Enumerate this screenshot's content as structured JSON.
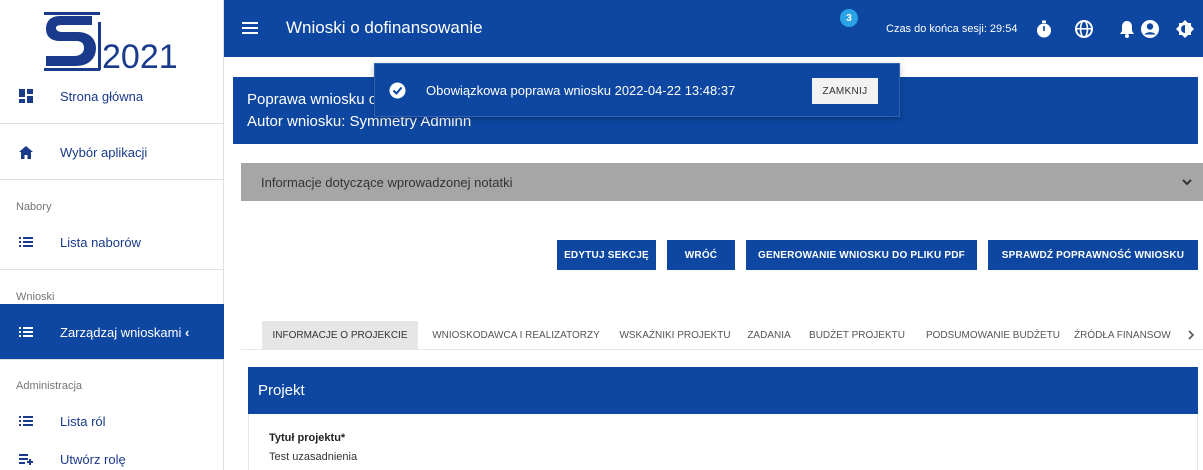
{
  "logo": {
    "text": "2021"
  },
  "sidebar": {
    "items": [
      {
        "label": "Strona główna",
        "icon": "dashboard-icon"
      },
      {
        "label": "Wybór aplikacji",
        "icon": "home-icon"
      },
      {
        "label": "Lista naborów",
        "icon": "list-icon"
      },
      {
        "label": "Zarządzaj wnioskami",
        "icon": "list-icon",
        "suffix": "‹"
      },
      {
        "label": "Lista ról",
        "icon": "list-icon"
      },
      {
        "label": "Utwórz rolę",
        "icon": "playlist-add-icon"
      }
    ],
    "sections": [
      "Nabory",
      "Wnioski",
      "Administracja"
    ]
  },
  "topbar": {
    "title": "Wnioski o dofinansowanie",
    "session": "Czas do końca sesji: 29:54",
    "notifications_count": "3"
  },
  "header": {
    "line1": "Poprawa wniosku o dofinansowanie - Test uzasadnienia",
    "line2": "Autor wniosku: Symmetry Adminn"
  },
  "toast": {
    "message": "Obowiązkowa poprawa wniosku 2022-04-22 13:48:37",
    "close_label": "ZAMKNIJ"
  },
  "accordion": {
    "label": "Informacje dotyczące wprowadzonej notatki"
  },
  "actions": {
    "edit": "EDYTUJ SEKCJĘ",
    "back": "WRÓĆ",
    "pdf": "GENEROWANIE WNIOSKU DO PLIKU PDF",
    "validate": "SPRAWDŹ POPRAWNOŚĆ WNIOSKU"
  },
  "tabs": [
    "INFORMACJE O PROJEKCIE",
    "WNIOSKODAWCA I REALIZATORZY",
    "WSKAŹNIKI PROJEKTU",
    "ZADANIA",
    "BUDŻET PROJEKTU",
    "PODSUMOWANIE BUDŻETU",
    "ŹRÓDŁA FINANSOW"
  ],
  "project": {
    "section_title": "Projekt",
    "field_label": "Tytuł projektu*",
    "field_value": "Test uzasadnienia"
  },
  "colors": {
    "primary": "#0d47a1",
    "accent": "#29a3e6",
    "accordion": "#a6a6a6"
  }
}
